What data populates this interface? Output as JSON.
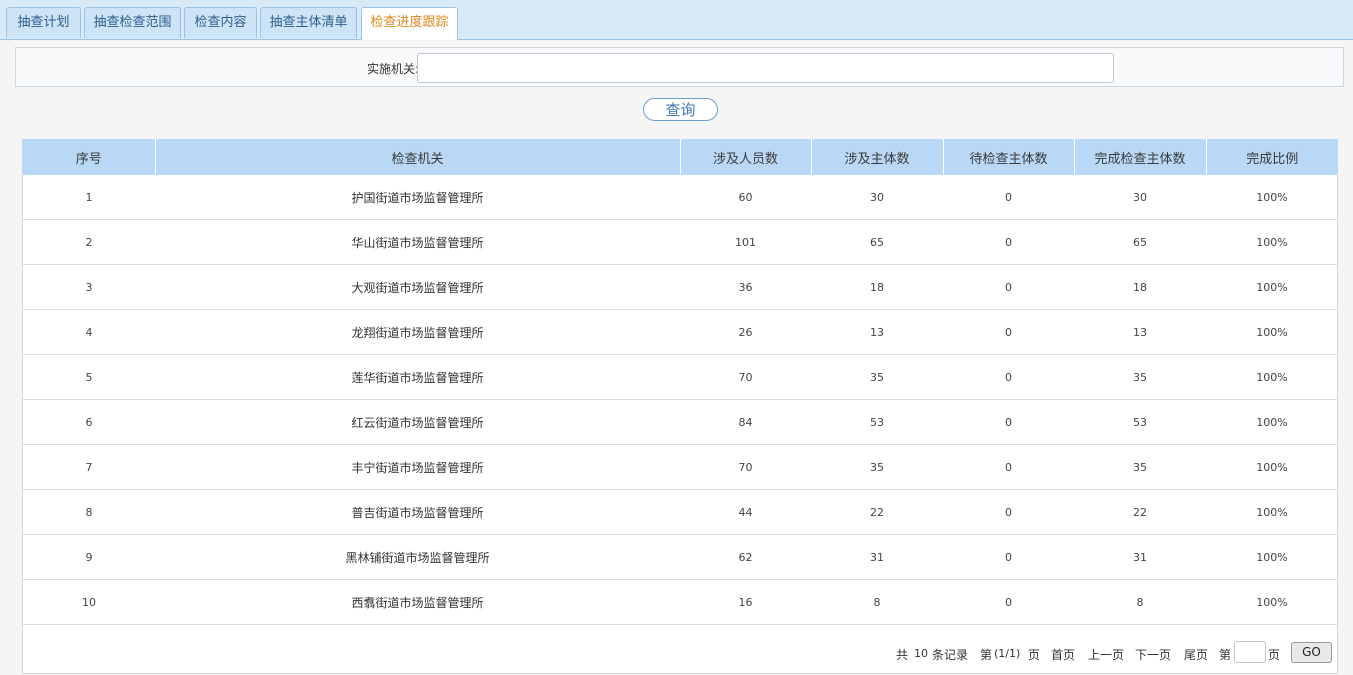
{
  "tabs": [
    {
      "label": "抽查计划",
      "active": false
    },
    {
      "label": "抽查检查范围",
      "active": false
    },
    {
      "label": "检查内容",
      "active": false
    },
    {
      "label": "抽查主体清单",
      "active": false
    },
    {
      "label": "检查进度跟踪",
      "active": true
    }
  ],
  "filter": {
    "label": "实施机关:",
    "value": "",
    "placeholder": ""
  },
  "query_button": "查询",
  "table": {
    "headers": [
      "序号",
      "检查机关",
      "涉及人员数",
      "涉及主体数",
      "待检查主体数",
      "完成检查主体数",
      "完成比例"
    ],
    "rows": [
      [
        "1",
        "护国街道市场监督管理所",
        "60",
        "30",
        "0",
        "30",
        "100%"
      ],
      [
        "2",
        "华山街道市场监督管理所",
        "101",
        "65",
        "0",
        "65",
        "100%"
      ],
      [
        "3",
        "大观街道市场监督管理所",
        "36",
        "18",
        "0",
        "18",
        "100%"
      ],
      [
        "4",
        "龙翔街道市场监督管理所",
        "26",
        "13",
        "0",
        "13",
        "100%"
      ],
      [
        "5",
        "莲华街道市场监督管理所",
        "70",
        "35",
        "0",
        "35",
        "100%"
      ],
      [
        "6",
        "红云街道市场监督管理所",
        "84",
        "53",
        "0",
        "53",
        "100%"
      ],
      [
        "7",
        "丰宁街道市场监督管理所",
        "70",
        "35",
        "0",
        "35",
        "100%"
      ],
      [
        "8",
        "普吉街道市场监督管理所",
        "44",
        "22",
        "0",
        "22",
        "100%"
      ],
      [
        "9",
        "黑林铺街道市场监督管理所",
        "62",
        "31",
        "0",
        "31",
        "100%"
      ],
      [
        "10",
        "西翥街道市场监督管理所",
        "16",
        "8",
        "0",
        "8",
        "100%"
      ]
    ]
  },
  "pager": {
    "total_prefix": "共",
    "total_count": "10",
    "total_suffix": "条记录",
    "page_prefix": "第",
    "page_info": "(1/1)",
    "page_suffix": "页",
    "first": "首页",
    "prev": "上一页",
    "next": "下一页",
    "last": "尾页",
    "goto_prefix": "第",
    "goto_value": "",
    "goto_suffix": "页",
    "go_button": "GO"
  },
  "colors": {
    "tab_active_text": "#e0851b",
    "tab_text": "#2d5f8b",
    "header_bg": "#b9d8f5",
    "query_button_text": "#3b78b5"
  }
}
